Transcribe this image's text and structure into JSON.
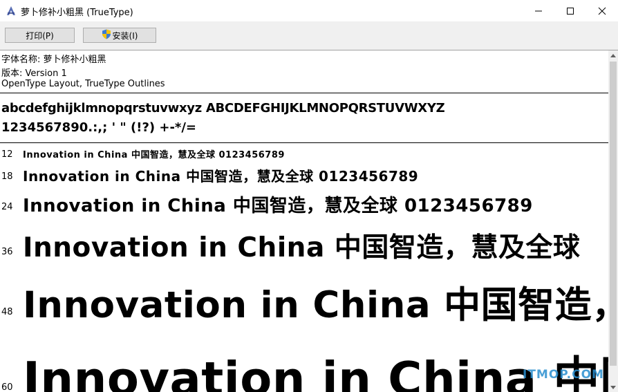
{
  "window": {
    "title": "萝卜修补小粗黑 (TrueType)",
    "minimize_glyph": "—",
    "maximize_glyph": "□",
    "close_glyph": "✕"
  },
  "toolbar": {
    "print_label": "打印(P)",
    "install_label": "安装(I)"
  },
  "font_info": {
    "name_line": "字体名称: 萝卜修补小粗黑",
    "version_line": "版本: Version 1",
    "outline_line": "OpenType Layout, TrueType Outlines"
  },
  "charset": {
    "letters": "abcdefghijklmnopqrstuvwxyz ABCDEFGHIJKLMNOPQRSTUVWXYZ",
    "digits": "1234567890.:,; ' \" (!?) +-*/="
  },
  "samples": [
    {
      "size": "12",
      "text": "Innovation in China 中国智造，慧及全球 0123456789"
    },
    {
      "size": "18",
      "text": "Innovation in China 中国智造，慧及全球 0123456789"
    },
    {
      "size": "24",
      "text": "Innovation in China 中国智造，慧及全球 0123456789"
    },
    {
      "size": "36",
      "text": "Innovation in China 中国智造，慧及全球"
    },
    {
      "size": "48",
      "text": "Innovation in China 中国智造，"
    },
    {
      "size": "60",
      "text": "Innovation in China 中国"
    }
  ],
  "watermark": "ITMOP.COM"
}
